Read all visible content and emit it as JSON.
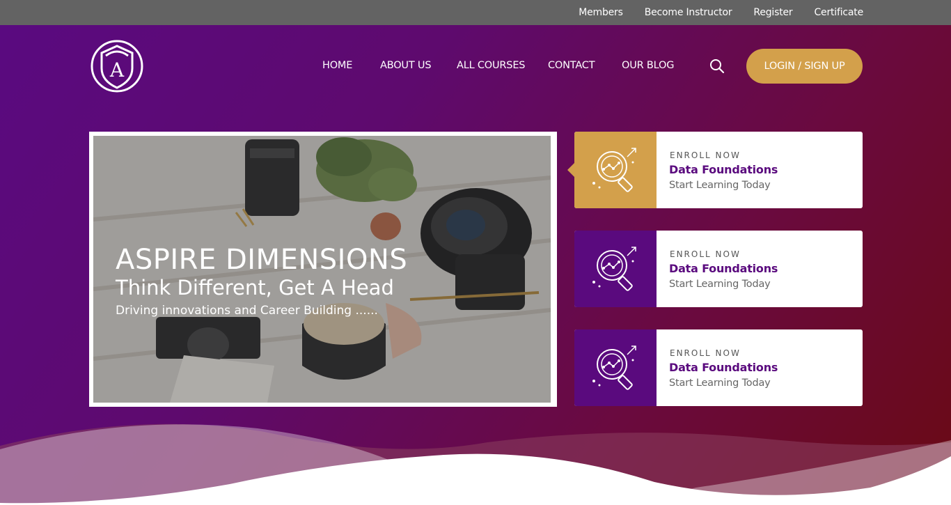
{
  "topbar": {
    "links": [
      "Members",
      "Become Instructor",
      "Register",
      "Certificate"
    ]
  },
  "brand": {
    "logo_letter": "A"
  },
  "nav": {
    "items": [
      "HOME",
      "ABOUT US",
      "ALL COURSES",
      "CONTACT",
      "OUR BLOG"
    ],
    "search_icon": "search-icon",
    "login_label": "LOGIN / SIGN UP"
  },
  "slider": {
    "title": "ASPIRE DIMENSIONS",
    "subtitle": "Think Different, Get A Head",
    "tagline": "Driving innovations and Career Building ......"
  },
  "courses": [
    {
      "enroll": "ENROLL NOW",
      "title": "Data Foundations",
      "subtitle": "Start Learning Today",
      "icon": "data-analysis-icon",
      "color": "#d3a04b"
    },
    {
      "enroll": "ENROLL NOW",
      "title": "Data Foundations",
      "subtitle": "Start Learning Today",
      "icon": "data-analysis-icon",
      "color": "#5a0a7e"
    },
    {
      "enroll": "ENROLL NOW",
      "title": "Data Foundations",
      "subtitle": "Start Learning Today",
      "icon": "data-analysis-icon",
      "color": "#5a0a7e"
    }
  ],
  "colors": {
    "topbar": "#636363",
    "accent_gold": "#d3a04b",
    "brand_purple": "#5a0a7e",
    "brand_maroon": "#6a0a14"
  }
}
